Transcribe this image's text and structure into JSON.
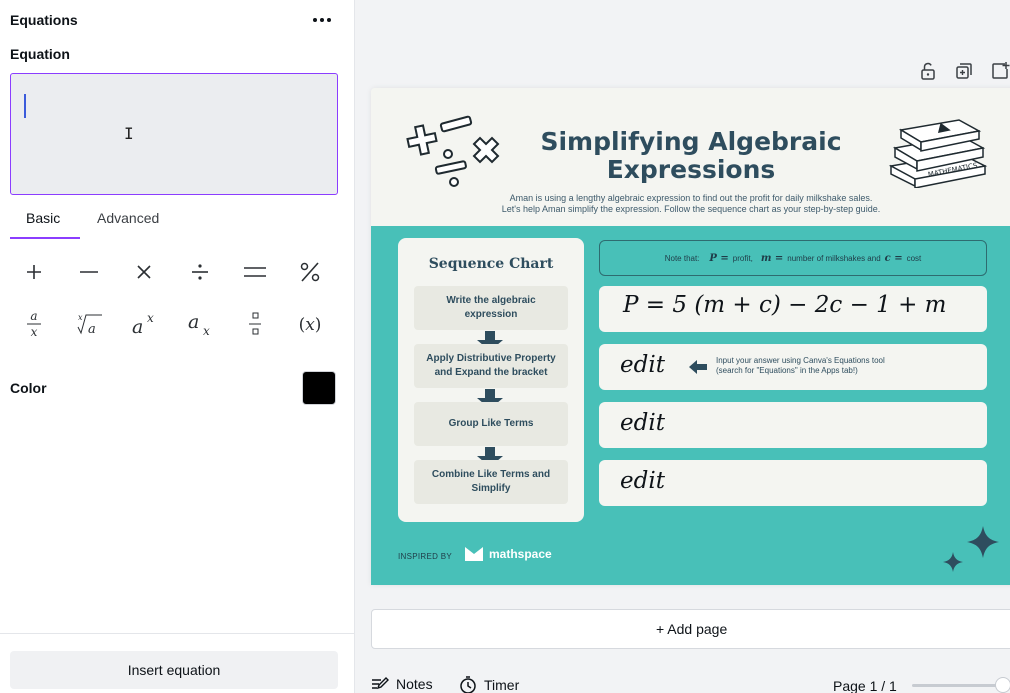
{
  "panel": {
    "title": "Equations",
    "field_label": "Equation",
    "tabs": [
      {
        "label": "Basic"
      },
      {
        "label": "Advanced"
      }
    ],
    "symbols": [
      {
        "label": "+",
        "icon": "plus-icon"
      },
      {
        "label": "−",
        "icon": "minus-icon"
      },
      {
        "label": "×",
        "icon": "times-icon"
      },
      {
        "label": "÷",
        "icon": "divide-icon"
      },
      {
        "label": "=",
        "icon": "equals-icon"
      },
      {
        "label": "%",
        "icon": "percent-icon"
      },
      {
        "label": "a/x",
        "icon": "fraction-icon"
      },
      {
        "label": "x√a",
        "icon": "root-icon"
      },
      {
        "label": "aˣ",
        "icon": "superscript-icon"
      },
      {
        "label": "aₓ",
        "icon": "subscript-icon"
      },
      {
        "label": "stacked",
        "icon": "stacked-fraction-icon"
      },
      {
        "label": "(x)",
        "icon": "parentheses-icon"
      }
    ],
    "color_label": "Color",
    "color_value": "#000000",
    "insert_label": "Insert equation"
  },
  "design": {
    "title_line1": "Simplifying Algebraic",
    "title_line2": "Expressions",
    "subtitle_line1": "Aman is using a lengthy algebraic expression to find out the profit for daily milkshake sales.",
    "subtitle_line2": "Let's help Aman simplify the expression. Follow the sequence chart as your step-by-step guide.",
    "book_label": "MATHEMATICS",
    "sequence_title": "Sequence Chart",
    "steps": [
      "Write the algebraic expression",
      "Apply Distributive Property and Expand the bracket",
      "Group Like Terms",
      "Combine Like Terms and Simplify"
    ],
    "note": {
      "prefix": "Note that:",
      "p_var": "P =",
      "p_text": "profit,",
      "m_var": "m =",
      "m_text": "number of milkshakes and",
      "c_var": "c =",
      "c_text": "cost"
    },
    "equation": "P = 5 (m + c) − 2c − 1 + m",
    "edit_label": "edit",
    "hint_line1": "Input your answer using Canva's Equations tool",
    "hint_line2": "(search for \"Equations\" in the Apps tab!)",
    "inspired": "INSPIRED BY",
    "brand": "mathspace",
    "colors": {
      "teal": "#48c0b8",
      "navy": "#2e4d5e",
      "accent": "#8b3dff"
    }
  },
  "canvas": {
    "add_page": "+ Add page",
    "notes": "Notes",
    "timer": "Timer",
    "page_indicator": "Page 1 / 1"
  }
}
